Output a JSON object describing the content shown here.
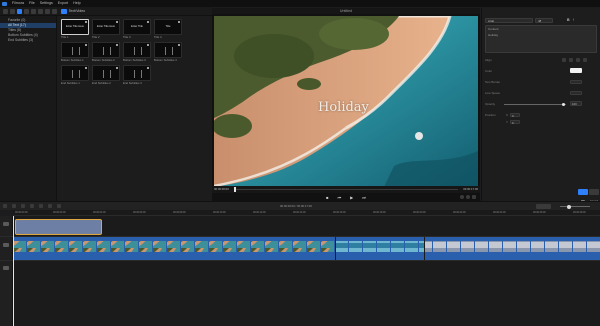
{
  "menubar": {
    "items": [
      "Filmora",
      "File",
      "Settings",
      "Export",
      "Help"
    ]
  },
  "toolbar": {
    "active_tab": "Text/Video"
  },
  "categories": [
    {
      "label": "Favorite (0)",
      "selected": false
    },
    {
      "label": "All Text (17)",
      "selected": true
    },
    {
      "label": "Titles (8)",
      "selected": false
    },
    {
      "label": "Bottom Subtitles (4)",
      "selected": false
    },
    {
      "label": "End Subtitles (3)",
      "selected": false
    }
  ],
  "thumbnails": [
    {
      "name": "Title 1",
      "text": "Enter Title Here",
      "selected": true
    },
    {
      "name": "Title 2",
      "text": "Enter Title Here"
    },
    {
      "name": "Title 3",
      "text": "Enter Title"
    },
    {
      "name": "Title 4",
      "text": "Title"
    },
    {
      "name": "Bottom Subtitles 1",
      "text": ""
    },
    {
      "name": "Bottom Subtitles 2",
      "text": ""
    },
    {
      "name": "Bottom Subtitles 3",
      "text": ""
    },
    {
      "name": "Bottom Subtitles 4",
      "text": ""
    },
    {
      "name": "End Subtitles 1",
      "text": ""
    },
    {
      "name": "End Subtitles 2",
      "text": ""
    },
    {
      "name": "End Subtitles 3",
      "text": ""
    }
  ],
  "viewer": {
    "title": "Untitled",
    "overlay_text": "Holiday",
    "current_time": "00:00:00:00",
    "total_time": "00:00:17:00"
  },
  "controls": {
    "prev": "⏮",
    "play": "▶",
    "next": "⏭"
  },
  "properties": {
    "font": "Arial",
    "size": "48",
    "content_label": "Content",
    "content_value": "Holiday",
    "align_label": "Align",
    "color_label": "Color",
    "text_border_label": "Text Border",
    "line_space_label": "Line Space",
    "opacity_label": "Opacity",
    "opacity_value": "100",
    "opacity_level": 0.96,
    "position_label": "Position",
    "pos_x": "0",
    "pos_y": "0",
    "ok_label": "OK",
    "cancel_label": "Cancel"
  },
  "timeline": {
    "timecode": "00:00:00:00 / 00:00:17:00",
    "export_label": "Export",
    "ruler": [
      "00:00:00:00",
      "00:00:02:00",
      "00:00:04:00",
      "00:00:06:00",
      "00:00:08:00",
      "00:00:10:00",
      "00:00:12:00",
      "00:00:14:00",
      "00:00:16:00",
      "00:00:18:00",
      "00:00:20:00",
      "00:00:22:00",
      "00:00:24:00",
      "00:00:26:00",
      "00:00:28:00"
    ]
  },
  "colors": {
    "accent": "#2f80ff",
    "clip_video": "#2a5fae",
    "clip_text": "#6e7fa6",
    "clip_selected_border": "#e0a640"
  }
}
